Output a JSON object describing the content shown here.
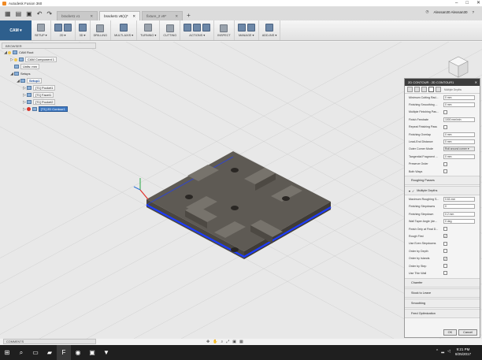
{
  "window": {
    "title": "Autodesk Fusion 360"
  },
  "tabs": [
    {
      "label": "bracket1 v1"
    },
    {
      "label": "bracket1 v9(1)*"
    },
    {
      "label": "fixture_2 v9*"
    }
  ],
  "user": {
    "name": "Alexsan30 Alexsan30"
  },
  "toolbar": {
    "workspace": "CAM ▾",
    "groups": [
      {
        "label": "SETUP ▾"
      },
      {
        "label": "2D ▾"
      },
      {
        "label": "3D ▾"
      },
      {
        "label": "DRILLING"
      },
      {
        "label": "MULTI-AXIS ▾"
      },
      {
        "label": "TURNING ▾"
      },
      {
        "label": "CUTTING"
      },
      {
        "label": "ACTIONS ▾"
      },
      {
        "label": "INSPECT"
      },
      {
        "label": "MANAGE ▾"
      },
      {
        "label": "ADD-INS ▾"
      }
    ]
  },
  "browser": {
    "header": "BROWSER",
    "items": [
      {
        "label": "CAM Root"
      },
      {
        "label": "CAM Component 1"
      },
      {
        "label": "Units: mm"
      },
      {
        "label": "Setups"
      },
      {
        "label": "Setup1"
      },
      {
        "label": "[T1] Pocket1"
      },
      {
        "label": "[T1] Facet1"
      },
      {
        "label": "[T1] Pocket2"
      },
      {
        "label": "[T1] 2D Contour1"
      }
    ]
  },
  "panel": {
    "title": "2D CONTOUR : 2D CONTOUR1",
    "tab_caption": "Multiple Depths",
    "rows1": [
      {
        "label": "Minimum Cutting Rad...",
        "value": "0 mm",
        "type": "text"
      },
      {
        "label": "Finishing Smoothing ...",
        "value": "0 mm",
        "type": "text"
      },
      {
        "label": "Multiple Finishing Pas...",
        "value": "",
        "type": "check"
      },
      {
        "label": "Finish Feedrate",
        "value": "1000 mm/min",
        "type": "text"
      },
      {
        "label": "Repeat Finishing Pass",
        "value": "",
        "type": "check"
      },
      {
        "label": "Finishing Overlap",
        "value": "0 mm",
        "type": "text"
      },
      {
        "label": "Lead-End Distance",
        "value": "0 mm",
        "type": "text"
      },
      {
        "label": "Outer Corner Mode",
        "value": "Roll around corner ▾",
        "type": "dd"
      },
      {
        "label": "Tangential Fragment ...",
        "value": "0 mm",
        "type": "text"
      },
      {
        "label": "Preserve Order",
        "value": "",
        "type": "check"
      },
      {
        "label": "Both Ways",
        "value": "",
        "type": "check"
      }
    ],
    "section_roughing": "Roughing Passes",
    "section_multi": "Multiple Depths",
    "rows2": [
      {
        "label": "Maximum Roughing S...",
        "value": "0.61 mm",
        "type": "text"
      },
      {
        "label": "Finishing Stepdowns",
        "value": "0",
        "type": "text"
      },
      {
        "label": "Finishing Stepdown",
        "value": "0.2 mm",
        "type": "text"
      },
      {
        "label": "Wall Taper Angle (de...",
        "value": "0 deg",
        "type": "text"
      },
      {
        "label": "Finish Only at Final D...",
        "value": "",
        "type": "check"
      },
      {
        "label": "Rough First",
        "value": "✓",
        "type": "check"
      },
      {
        "label": "Use Even Stepdowns",
        "value": "",
        "type": "check"
      },
      {
        "label": "Order by Depth",
        "value": "",
        "type": "check"
      },
      {
        "label": "Order by Islands",
        "value": "✓",
        "type": "check"
      },
      {
        "label": "Order by Step",
        "value": "",
        "type": "check"
      },
      {
        "label": "Use Thin Wall",
        "value": "",
        "type": "check"
      }
    ],
    "sections_bottom": [
      "Chamfer",
      "Stock to Leave",
      "Smoothing",
      "Feed Optimization"
    ],
    "ok": "OK",
    "cancel": "Cancel"
  },
  "comments": {
    "label": "COMMENTS"
  },
  "taskbar": {
    "time": "9:21 PM",
    "date": "8/25/2017"
  }
}
